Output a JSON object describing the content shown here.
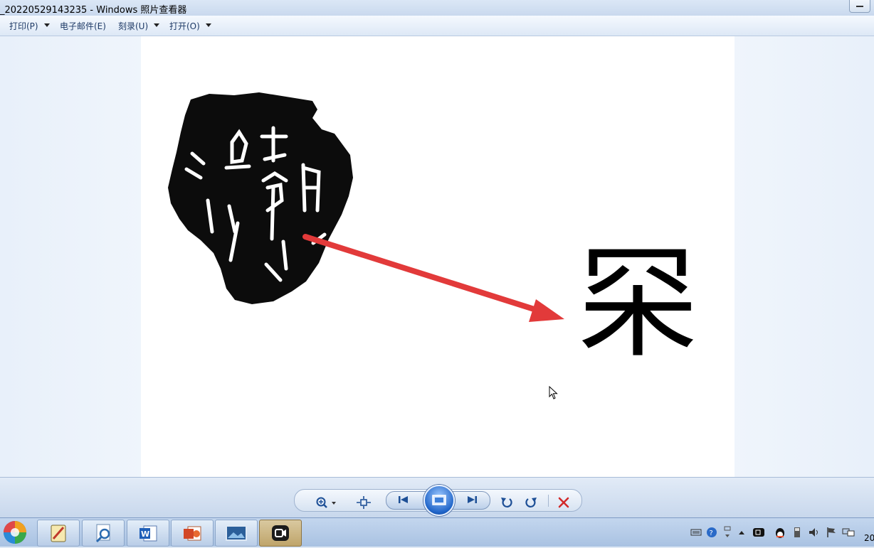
{
  "window": {
    "title": "_20220529143235 - Windows 照片查看器"
  },
  "menu": {
    "print": "打印(P)",
    "email": "电子邮件(E)",
    "burn": "刻录(U)",
    "open": "打开(O)"
  },
  "image": {
    "character": "罙",
    "arrow_color": "#e23a3a"
  },
  "controls": {
    "icons": [
      "zoom-icon",
      "actual-size-icon",
      "previous-icon",
      "slideshow-icon",
      "next-icon",
      "rotate-ccw-icon",
      "rotate-cw-icon",
      "delete-icon"
    ],
    "delete_color": "#d22a2a"
  },
  "taskbar": {
    "apps": [
      "start-orb-icon",
      "notepad-pen-icon",
      "search-app-icon",
      "word-icon",
      "powerpoint-icon",
      "photo-viewer-icon",
      "camera-app-icon"
    ],
    "clock_fragment": "20"
  }
}
